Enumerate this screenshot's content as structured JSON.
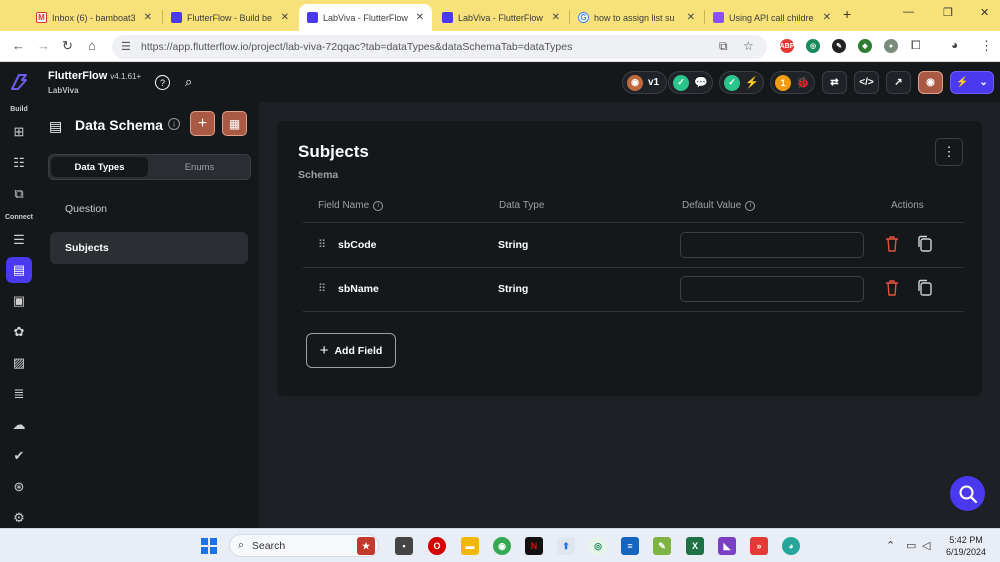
{
  "browser": {
    "tabs": [
      {
        "title": "Inbox (6) - bamboat3",
        "icon": "gmail-icon",
        "color": "#d93025"
      },
      {
        "title": "FlutterFlow - Build be",
        "icon": "flutterflow-icon",
        "color": "#4b39ef"
      },
      {
        "title": "LabViva - FlutterFlow",
        "icon": "flutterflow-icon",
        "color": "#4b39ef"
      },
      {
        "title": "LabViva - FlutterFlow",
        "icon": "flutterflow-icon",
        "color": "#4b39ef"
      },
      {
        "title": "how to assign list su",
        "icon": "google-icon",
        "color": "#4285f4"
      },
      {
        "title": "Using API call childre",
        "icon": "forum-icon",
        "color": "#8a4fff"
      }
    ],
    "active_tab": 2,
    "url": "https://app.flutterflow.io/project/lab-viva-72qqac?tab=dataTypes&dataSchemaTab=dataTypes"
  },
  "app": {
    "brand": "FlutterFlow",
    "version": "v4.1.61+",
    "project": "LabViva",
    "rail": {
      "build_label": "Build",
      "connect_label": "Connect"
    },
    "topbar": {
      "version_badge": "v1",
      "warning_count": "1"
    }
  },
  "side_panel": {
    "title": "Data Schema",
    "segments": {
      "selected": "Data Types",
      "other": "Enums"
    },
    "items": [
      "Question",
      "Subjects"
    ],
    "selected_index": 1
  },
  "schema": {
    "title": "Subjects",
    "subtitle": "Schema",
    "columns": {
      "field_name": "Field Name",
      "data_type": "Data Type",
      "default_value": "Default Value",
      "actions": "Actions"
    },
    "fields": [
      {
        "name": "sbCode",
        "type": "String",
        "default": ""
      },
      {
        "name": "sbName",
        "type": "String",
        "default": ""
      }
    ],
    "add_field_label": "Add Field"
  },
  "taskbar": {
    "search_placeholder": "Search",
    "time": "5:42 PM",
    "date": "6/19/2024"
  },
  "colors": {
    "accent": "#4b39ef",
    "schema_button": "#aa5a44",
    "delete": "#e5533d",
    "success": "#2bc48a",
    "warning": "#f39c12"
  }
}
